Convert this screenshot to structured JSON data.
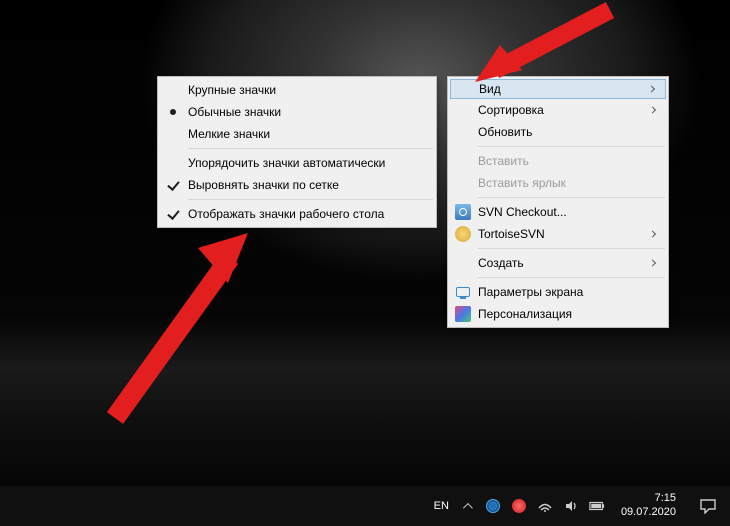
{
  "submenu": {
    "items": [
      {
        "label": "Крупные значки",
        "checked": false,
        "type": "radio"
      },
      {
        "label": "Обычные значки",
        "checked": true,
        "type": "radio"
      },
      {
        "label": "Мелкие значки",
        "checked": false,
        "type": "radio"
      }
    ],
    "items2": [
      {
        "label": "Упорядочить значки автоматически",
        "checked": false
      },
      {
        "label": "Выровнять значки по сетке",
        "checked": true
      }
    ],
    "items3": [
      {
        "label": "Отображать значки рабочего стола",
        "checked": true
      }
    ]
  },
  "mainmenu": {
    "g1": [
      {
        "label": "Вид",
        "arrow": true,
        "highlight": true
      },
      {
        "label": "Сортировка",
        "arrow": true
      },
      {
        "label": "Обновить",
        "arrow": false
      }
    ],
    "g2": [
      {
        "label": "Вставить",
        "disabled": true
      },
      {
        "label": "Вставить ярлык",
        "disabled": true
      }
    ],
    "g3": [
      {
        "label": "SVN Checkout...",
        "icon": "svn-icon"
      },
      {
        "label": "TortoiseSVN",
        "icon": "tortoisesvn-icon",
        "arrow": true
      }
    ],
    "g4": [
      {
        "label": "Создать",
        "arrow": true
      }
    ],
    "g5": [
      {
        "label": "Параметры экрана",
        "icon": "display-icon"
      },
      {
        "label": "Персонализация",
        "icon": "personalize-icon"
      }
    ]
  },
  "tray": {
    "lang": "EN",
    "time": "7:15",
    "date": "09.07.2020"
  }
}
